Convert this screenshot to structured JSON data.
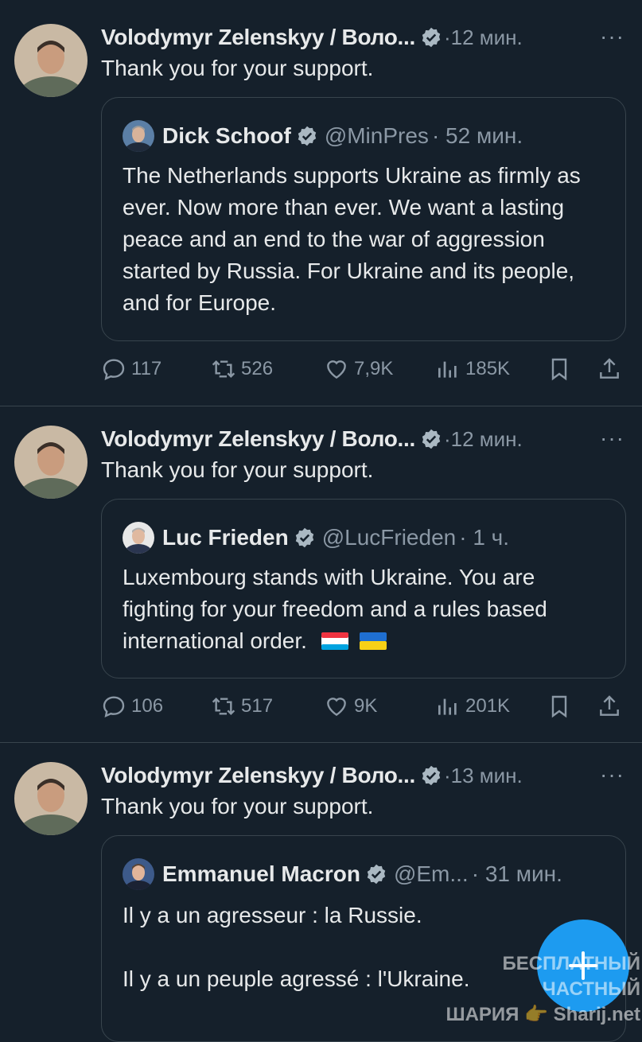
{
  "tweets": [
    {
      "author": "Volodymyr Zelenskyy / Воло...",
      "time": "·12 мин.",
      "more": "···",
      "text": "Thank you for your support.",
      "quote": {
        "name": "Dick Schoof",
        "handle": "@MinPres",
        "time": "· 52 мин.",
        "lines": [
          "The Netherlands supports Ukraine as firmly as ever. Now more than ever. We want a lasting peace and an end to the war of aggression started by Russia. For Ukraine and its people, and for Europe."
        ]
      },
      "stats": {
        "replies": "117",
        "reposts": "526",
        "likes": "7,9K",
        "views": "185K"
      }
    },
    {
      "author": "Volodymyr Zelenskyy / Воло...",
      "time": "·12 мин.",
      "more": "···",
      "text": "Thank you for your support.",
      "quote": {
        "name": "Luc Frieden",
        "handle": "@LucFrieden",
        "time": "· 1 ч.",
        "lines": [
          "Luxembourg stands with Ukraine. You are fighting for your freedom and a rules based international order."
        ]
      },
      "stats": {
        "replies": "106",
        "reposts": "517",
        "likes": "9K",
        "views": "201K"
      }
    },
    {
      "author": "Volodymyr Zelenskyy / Воло...",
      "time": "·13 мин.",
      "more": "···",
      "text": "Thank you for your support.",
      "quote": {
        "name": "Emmanuel Macron",
        "handle": "@Em...",
        "time": "· 31 мин.",
        "lines": [
          "Il y a un agresseur : la Russie.",
          "Il y a un peuple agressé : l'Ukraine."
        ]
      }
    }
  ],
  "flags": [
    "luxembourg-flag",
    "ukraine-flag"
  ],
  "watermark": {
    "line1": "БЕСПЛАТНЫЙ ЧАСТНЫЙ",
    "line2": "ШАРИЯ 👉 Sharij.net"
  },
  "colors": {
    "background": "#15202b",
    "accent": "#1d9bf0",
    "muted": "#8b98a5",
    "border": "#38444d"
  }
}
